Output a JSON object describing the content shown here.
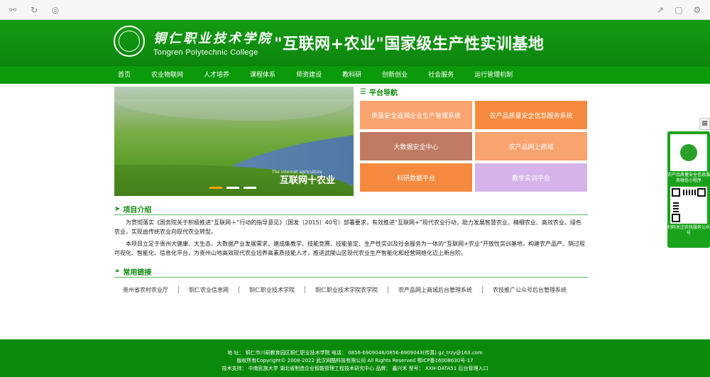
{
  "header": {
    "logo_cn": "铜仁职业技术学院",
    "logo_en": "Tongren Polytechnic College",
    "title": "\"互联网+农业\"国家级生产性实训基地"
  },
  "nav": {
    "items": [
      "首页",
      "农业物联网",
      "人才培养",
      "课程体系",
      "师资建设",
      "教科研",
      "创新创业",
      "社会服务",
      "运行管理机制"
    ]
  },
  "banner": {
    "caption": "互联网十农业",
    "caption_en": "The internet agriculture"
  },
  "platform": {
    "title": "平台导航",
    "cells": [
      {
        "label": "质量安全追溯企业生产管理系统",
        "color": "#f9a36f"
      },
      {
        "label": "农产品质量安全信息服务系统",
        "color": "#f58a3e"
      },
      {
        "label": "大数据安全中心",
        "color": "#c07a62"
      },
      {
        "label": "农产品网上商城",
        "color": "#f9a36f"
      },
      {
        "label": "科研数据平台",
        "color": "#f58a3e"
      },
      {
        "label": "教学实训平台",
        "color": "#d5b4ea"
      }
    ]
  },
  "intro": {
    "title": "项目介绍",
    "p1": "为贯彻落实《国务院关于积极推进“互联网＋”行动的指导意见》（国发〔2015〕40号）部署要求，有效推进“互联网+”现代农业行动，助力发展智慧农业、精细农业、高效农业、绿色农业，实现由传统农业向现代农业转型。",
    "p2": "本项目立足于贵州大健康、大生态、大数据产业发展需求，建成集教学、技能竞赛、技能鉴定、生产性实训及社会服务为一体的“互联网+农业”开放性实训基地，构建农产品产、销过程可视化、智能化、信息化平台，为贵州山地高效现代农业培养高素质技能人才，推进武陵山区现代农业生产智能化和经营网络化迈上新台阶。"
  },
  "links": {
    "title": "常用链接",
    "items": [
      "贵州省农村农业厅",
      "铜仁农业信息网",
      "铜仁职业技术学院",
      "铜仁职业技术学院农学院",
      "农产品网上商城后台管理系统",
      "农技推广公众号后台管理系统"
    ]
  },
  "footer": {
    "line1": "地 址： 铜仁市川硐教育园区铜仁职业技术学院    电话： 0856-6909046/0856-6909043(传真)    gz_trzy@163.com",
    "line2": "版权所有Copyright© 2008-2022 武汉网酷科技有限公司 All Rights Reserved    鄂ICP备16008630号-17",
    "line3": "技术支持： 中南民族大学 湖北省制造企业智能管理工程技术研究中心  品牌： 鑫兴禾  型号： XXH-DATA51      后台管理入口"
  },
  "side": {
    "qr1_text": "农产品质量安全信息服务微信小程序",
    "qr2_text": "扫码关注农技服务公众号"
  }
}
